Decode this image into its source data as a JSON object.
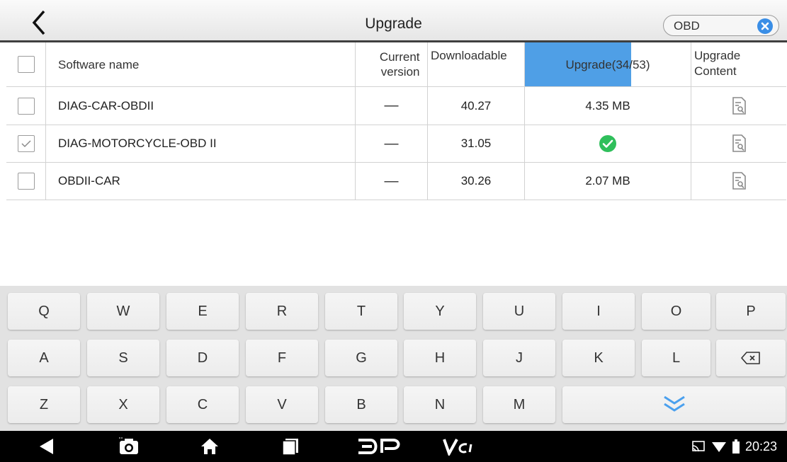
{
  "header": {
    "title": "Upgrade",
    "search": {
      "value": "OBD"
    }
  },
  "table": {
    "columns": {
      "name": "Software name",
      "current": "Current version",
      "downloadable": "Downloadable",
      "upgrade": "Upgrade(34/53)",
      "content": "Upgrade Content"
    },
    "upgrade_progress": 0.64,
    "rows": [
      {
        "name": "DIAG-CAR-OBDII",
        "current": "—",
        "downloadable": "40.27",
        "size": "4.35 MB",
        "checked": false
      },
      {
        "name": "DIAG-MOTORCYCLE-OBD II",
        "current": "—",
        "downloadable": "31.05",
        "size": "",
        "done": true,
        "checked": true
      },
      {
        "name": "OBDII-CAR",
        "current": "—",
        "downloadable": "30.26",
        "size": "2.07 MB",
        "checked": false
      }
    ]
  },
  "keyboard": {
    "row1": [
      "Q",
      "W",
      "E",
      "R",
      "T",
      "Y",
      "U",
      "I",
      "O",
      "P"
    ],
    "row2": [
      "A",
      "S",
      "D",
      "F",
      "G",
      "H",
      "J",
      "K",
      "L"
    ],
    "row3": [
      "Z",
      "X",
      "C",
      "V",
      "B",
      "N",
      "M"
    ],
    "icons": {
      "backspace": "backspace-icon",
      "hide": "keyboard-hide-icon"
    }
  },
  "navbar": {
    "time": "20:23",
    "icons": [
      "back-triangle-icon",
      "screenshot-icon",
      "home-icon",
      "recents-icon",
      "dp-logo-icon",
      "vci-logo-icon",
      "cast-icon",
      "wifi-icon",
      "battery-icon"
    ]
  },
  "colors": {
    "accent": "#4f9fe6",
    "ok": "#2fbf5b",
    "clear": "#3a8ee6"
  }
}
